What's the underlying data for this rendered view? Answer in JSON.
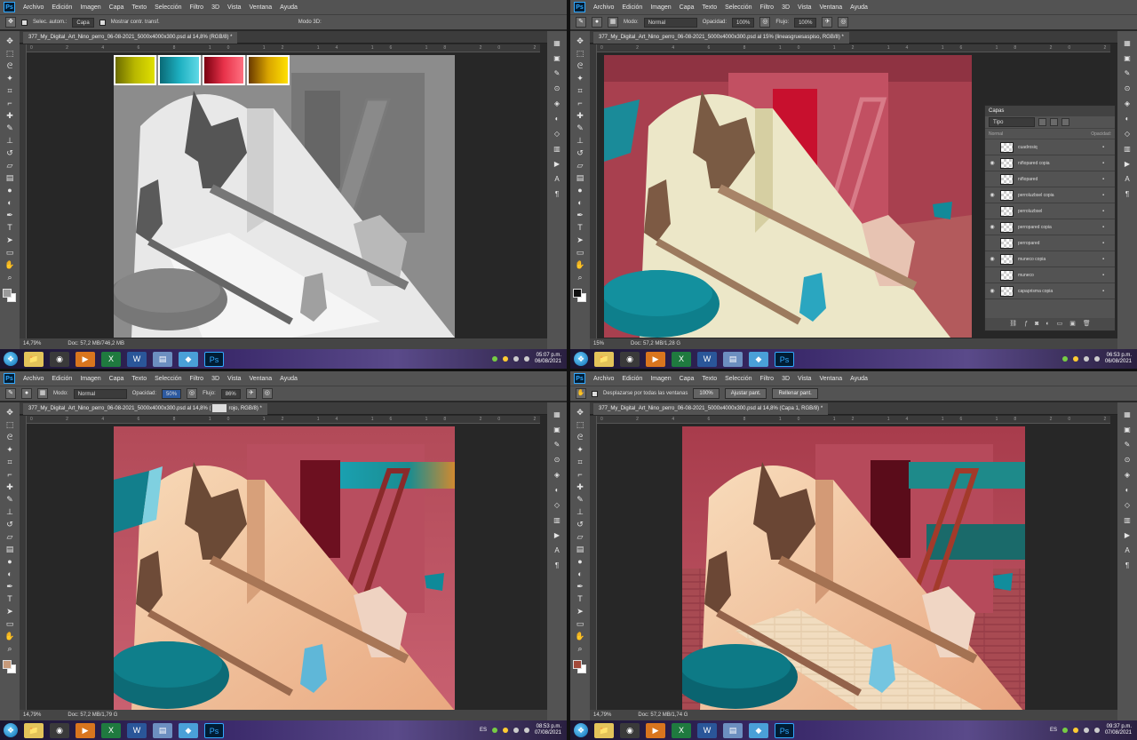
{
  "menu": [
    "Archivo",
    "Edición",
    "Imagen",
    "Capa",
    "Texto",
    "Selección",
    "Filtro",
    "3D",
    "Vista",
    "Ventana",
    "Ayuda"
  ],
  "q0": {
    "options": {
      "auto_select": "Selec. autom.:",
      "target": "Capa",
      "transform": "Mostrar contr. transf.",
      "mode3d": "Modo 3D:"
    },
    "tab": "377_My_Digital_Art_Nino_perro_06-08-2021_5000x4000x300.psd al 14,8% (RGB/8) *",
    "zoom": "14,79%",
    "doc": "Doc: 57,2 MB/746,2 MB",
    "clock_time": "05:07 p.m.",
    "clock_date": "06/08/2021",
    "swatches": [
      "#b9b800",
      "#1dafc0",
      "#e8324a",
      "#d9a400"
    ]
  },
  "q1": {
    "options": {
      "mode_label": "Modo:",
      "mode": "Normal",
      "opacity_label": "Opacidad:",
      "opacity": "100%",
      "flow_label": "Flujo:",
      "flow": "100%"
    },
    "tab": "377_My_Digital_Art_Nino_perro_06-08-2021_5000x4000x300.psd al 15% (lineasgruesaspiso, RGB/8) *",
    "zoom": "15%",
    "doc": "Doc: 57,2 MB/1,28 G",
    "clock_time": "06:53 p.m.",
    "clock_date": "06/08/2021",
    "layers": {
      "title": "Capas",
      "kind": "Tipo",
      "blend": "Normal",
      "opacity": "Opacidad:",
      "rows": [
        {
          "name": "cuadrosiq",
          "visible": false
        },
        {
          "name": "niñopared copia",
          "visible": true
        },
        {
          "name": "niñopared",
          "visible": false
        },
        {
          "name": "perroluzbsel copia",
          "visible": true
        },
        {
          "name": "perroluzbsel",
          "visible": false
        },
        {
          "name": "perropared copia",
          "visible": true
        },
        {
          "name": "perropared",
          "visible": false
        },
        {
          "name": "muneco copia",
          "visible": true
        },
        {
          "name": "muneco",
          "visible": false
        },
        {
          "name": "capaprisma copia",
          "visible": true
        }
      ]
    }
  },
  "q2": {
    "options": {
      "mode_label": "Modo:",
      "mode": "Normal",
      "opacity_label": "Opacidad:",
      "opacity": "50%",
      "flow_label": "Flujo:",
      "flow": "86%"
    },
    "tab": "377_My_Digital_Art_Nino_perro_06-08-2021_5000x4000x300.psd al 14,8% (",
    "tab_suffix": "rojo, RGB/8) *",
    "zoom": "14,79%",
    "doc": "Doc: 57,2 MB/1,79 G",
    "clock_time": "08:53 p.m.",
    "clock_date": "07/08/2021",
    "lang": "ES"
  },
  "q3": {
    "options": {
      "scroll_all": "Desplazarse por todas las ventanas",
      "zoom": "100%",
      "fit": "Ajustar pant.",
      "fill": "Rellenar pant."
    },
    "tab": "377_My_Digital_Art_Nino_perro_06-08-2021_5000x4000x300.psd al 14,8% (Capa 1, RGB/8) *",
    "zoom": "14,79%",
    "doc": "Doc: 57,2 MB/1,74 G",
    "clock_time": "09:37 p.m.",
    "clock_date": "07/08/2021",
    "lang": "ES"
  },
  "ps_logo": "Ps"
}
